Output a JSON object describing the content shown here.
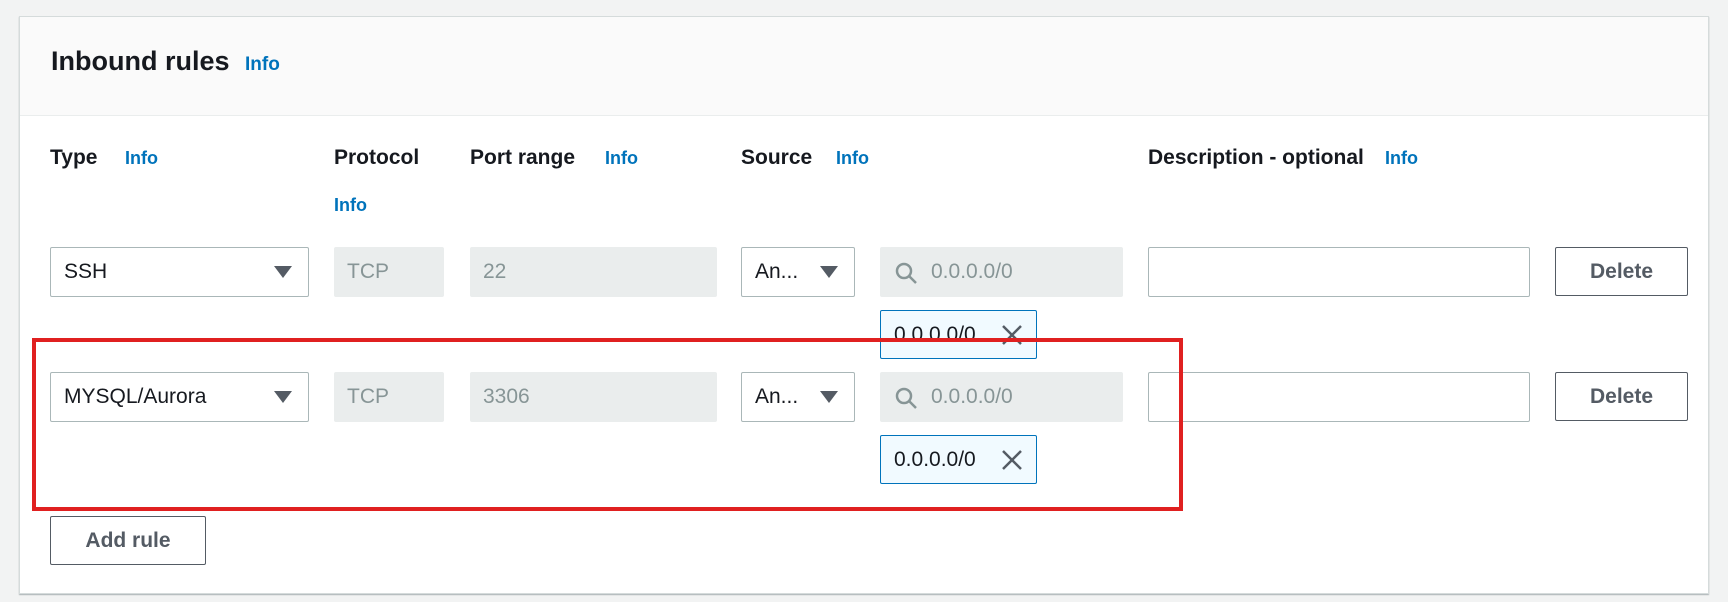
{
  "section": {
    "title": "Inbound rules",
    "info": "Info"
  },
  "columns": {
    "type": "Type",
    "protocol": "Protocol",
    "port_range": "Port range",
    "source": "Source",
    "description": "Description - optional",
    "info": "Info"
  },
  "rules": [
    {
      "type": "SSH",
      "protocol": "TCP",
      "port_range": "22",
      "source_type": "An...",
      "source_placeholder": "0.0.0.0/0",
      "cidr_tag": "0.0.0.0/0",
      "description": "",
      "delete_label": "Delete"
    },
    {
      "type": "MYSQL/Aurora",
      "protocol": "TCP",
      "port_range": "3306",
      "source_type": "An...",
      "source_placeholder": "0.0.0.0/0",
      "cidr_tag": "0.0.0.0/0",
      "description": "",
      "delete_label": "Delete"
    }
  ],
  "add_rule_label": "Add rule",
  "icons": {
    "caret": "caret-down-icon",
    "search": "search-icon",
    "remove": "close-icon"
  },
  "colors": {
    "link": "#0073bb",
    "highlight": "#e02020"
  }
}
